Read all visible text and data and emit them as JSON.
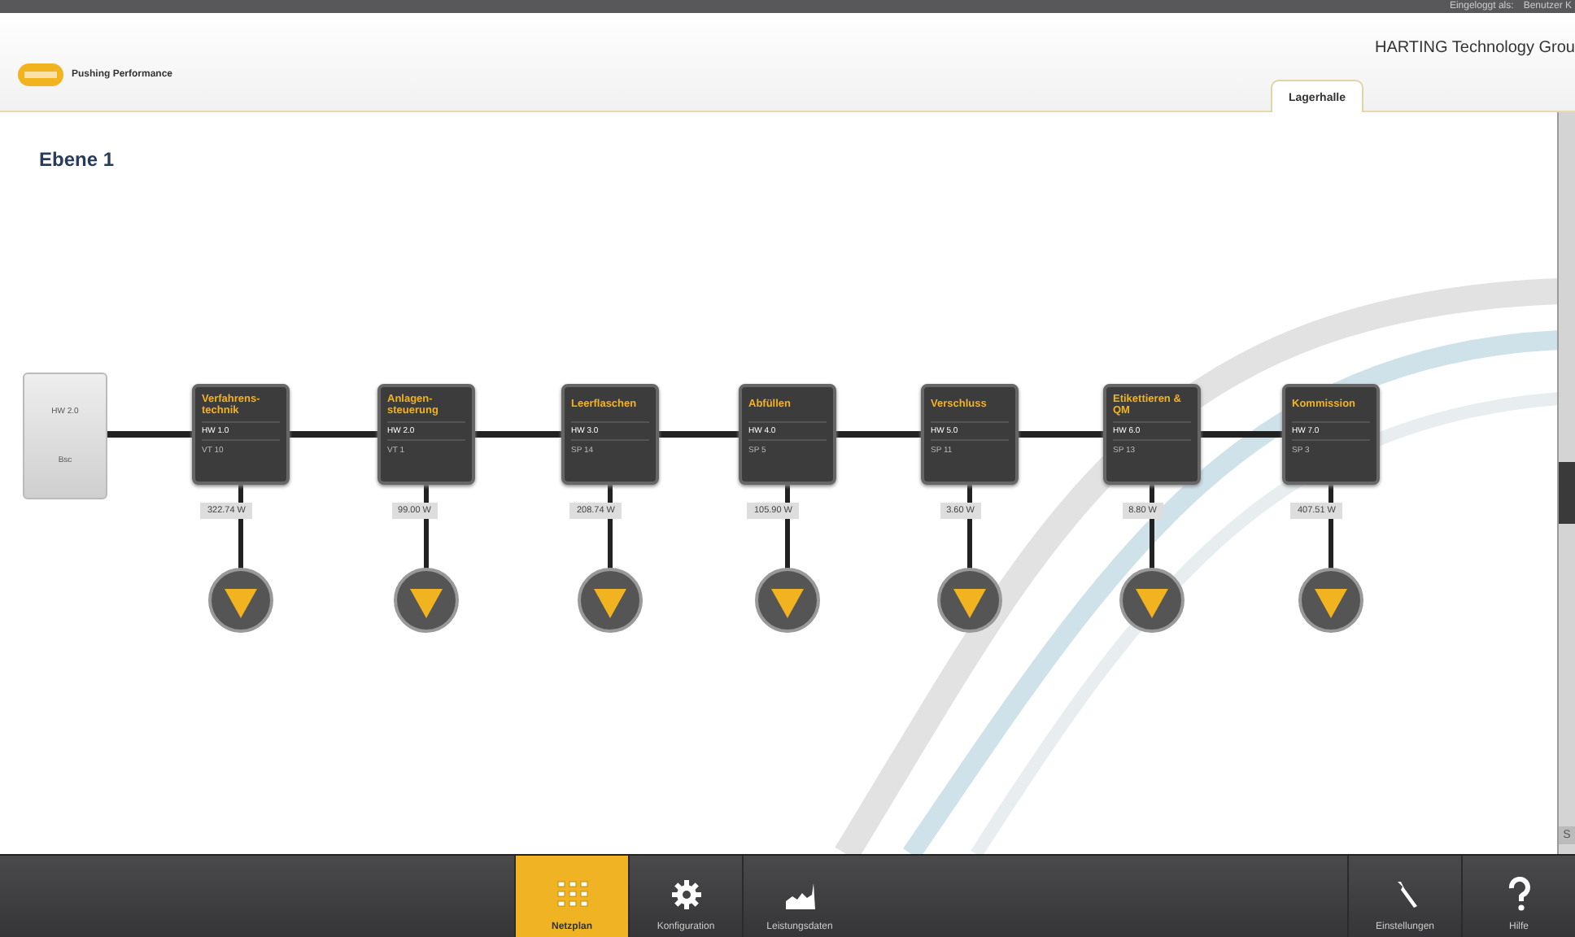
{
  "top_bar": {
    "user_label": "Eingeloggt als:",
    "user_name": "Benutzer K"
  },
  "header": {
    "slogan": "Pushing Performance",
    "company": "HARTING Technology Grou",
    "tabs": [
      {
        "label": "Lagerhalle",
        "selected": true
      }
    ]
  },
  "main": {
    "title": "Ebene 1",
    "source": {
      "line_1": "HW 2.0",
      "line_2": "Bsc"
    },
    "nodes": [
      {
        "name": "Verfahrens-technik",
        "hw": "HW 1.0",
        "id": "VT 10",
        "power": "322.74 W"
      },
      {
        "name": "Anlagen-steuerung",
        "hw": "HW 2.0",
        "id": "VT 1",
        "power": "99.00 W"
      },
      {
        "name": "Leerflaschen",
        "hw": "HW 3.0",
        "id": "SP 14",
        "power": "208.74 W"
      },
      {
        "name": "Abfüllen",
        "hw": "HW 4.0",
        "id": "SP 5",
        "power": "105.90 W"
      },
      {
        "name": "Verschluss",
        "hw": "HW 5.0",
        "id": "SP 11",
        "power": "3.60 W"
      },
      {
        "name": "Etikettieren & QM",
        "hw": "HW 6.0",
        "id": "SP 13",
        "power": "8.80 W"
      },
      {
        "name": "Kommission",
        "hw": "HW 7.0",
        "id": "SP 3",
        "power": "407.51 W"
      }
    ]
  },
  "side_panel": {
    "label": "S"
  },
  "bottom_bar": {
    "nav": [
      {
        "label": "Netzplan",
        "selected": true
      },
      {
        "label": "Konfiguration",
        "selected": false
      },
      {
        "label": "Leistungsdaten",
        "selected": false
      }
    ],
    "tools": [
      {
        "label": "Einstellungen"
      },
      {
        "label": "Hilfe"
      }
    ]
  }
}
